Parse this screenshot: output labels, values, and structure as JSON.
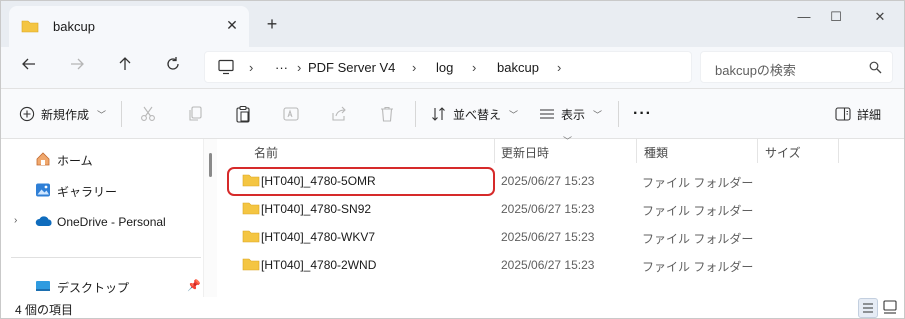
{
  "tab": {
    "title": "bakcup",
    "close_glyph": "✕",
    "new_glyph": "+"
  },
  "window_controls": {
    "minimize": "—",
    "maximize": "☐",
    "close": "✕"
  },
  "address": {
    "crumbs": [
      "PDF Server V4",
      "log",
      "bakcup"
    ],
    "ellipsis": "···",
    "separator": "›",
    "search_placeholder": "bakcupの検索"
  },
  "toolbar": {
    "new_label": "新規作成",
    "sort_label": "並べ替え",
    "view_label": "表示",
    "more_label": "···",
    "details_label": "詳細"
  },
  "nav": {
    "items": [
      {
        "label": "ホーム",
        "icon": "home-icon"
      },
      {
        "label": "ギャラリー",
        "icon": "gallery-icon"
      },
      {
        "label": "OneDrive - Personal",
        "icon": "onedrive-icon"
      },
      {
        "label": "デスクトップ",
        "icon": "desktop-icon"
      }
    ]
  },
  "columns": {
    "name": "名前",
    "date": "更新日時",
    "type": "種類",
    "size": "サイズ"
  },
  "files": [
    {
      "name": "[HT040]_4780-5OMR",
      "date": "2025/06/27 15:23",
      "type": "ファイル フォルダー"
    },
    {
      "name": "[HT040]_4780-SN92",
      "date": "2025/06/27 15:23",
      "type": "ファイル フォルダー"
    },
    {
      "name": "[HT040]_4780-WKV7",
      "date": "2025/06/27 15:23",
      "type": "ファイル フォルダー"
    },
    {
      "name": "[HT040]_4780-2WND",
      "date": "2025/06/27 15:23",
      "type": "ファイル フォルダー"
    }
  ],
  "status": {
    "item_count": "4 個の項目"
  },
  "colors": {
    "folder": "#f4c542",
    "highlight": "#d62a2a",
    "accent": "#0f6cbd"
  }
}
